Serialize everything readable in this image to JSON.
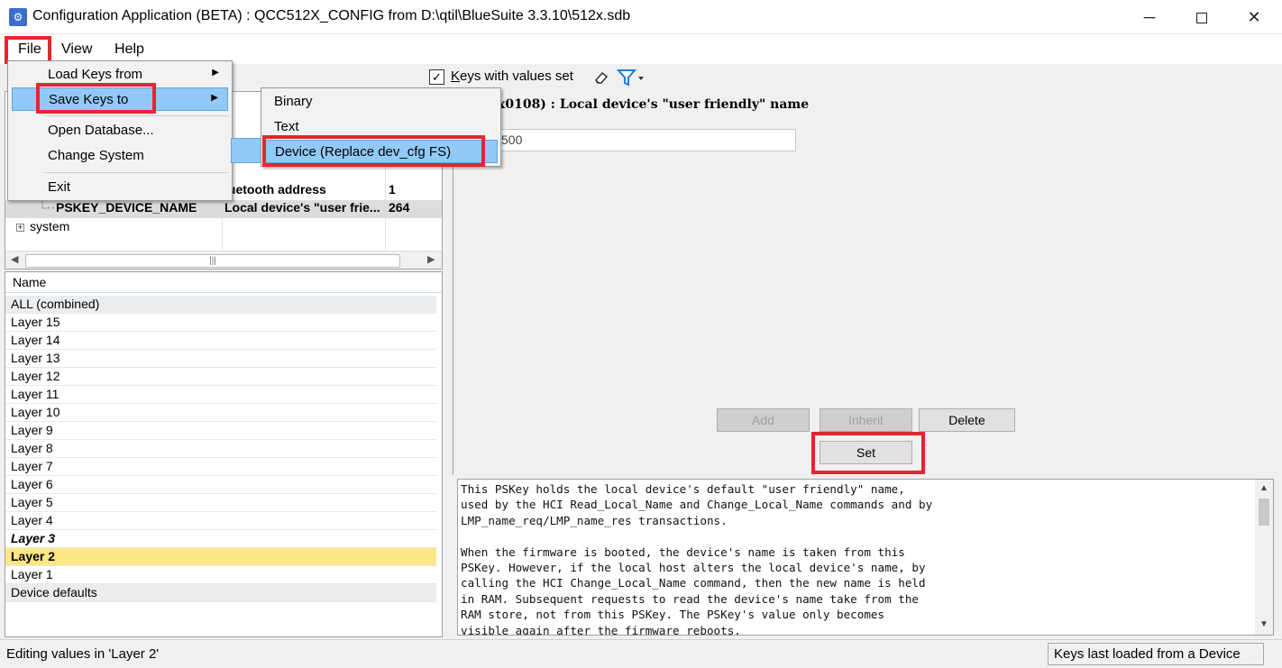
{
  "window": {
    "title": "Configuration Application (BETA) : QCC512X_CONFIG from D:\\qtil\\BlueSuite 3.3.10\\512x.sdb",
    "minimize": "─",
    "close": "✕"
  },
  "menubar": {
    "file": "File",
    "view": "View",
    "help": "Help"
  },
  "toolbar": {
    "keys_with_values_prefix": "K",
    "keys_with_values_rest": "eys with values set",
    "checked": "✓"
  },
  "file_menu": {
    "load_keys": "Load Keys from",
    "save_keys": "Save Keys to",
    "open_database": "Open Database...",
    "change_system": "Change System",
    "exit": "Exit",
    "arrow": "▶"
  },
  "save_submenu": {
    "binary": "Binary",
    "text": "Text",
    "device": "Device (Replace dev_cfg FS)"
  },
  "tree": {
    "bt_col2": "luetooth address",
    "bt_col3": "1",
    "pskey_col1": "PSKEY_DEVICE_NAME",
    "pskey_col2": "Local device's \"user frie...",
    "pskey_col3": "264",
    "system_label": "system",
    "expander": "+",
    "scroll_grip": "|||"
  },
  "layers": {
    "header": "Name",
    "items": [
      "ALL (combined)",
      "Layer 15",
      "Layer 14",
      "Layer 13",
      "Layer 12",
      "Layer 11",
      "Layer 10",
      "Layer 9",
      "Layer 8",
      "Layer 7",
      "Layer 6",
      "Layer 5",
      "Layer 4",
      "Layer 3",
      "Layer 2",
      "Layer 1",
      "Device defaults"
    ],
    "selected": "Layer 2"
  },
  "editor": {
    "key_title": "x0108) : Local device's \"user friendly\" name",
    "value": "500",
    "add": "Add",
    "inherit": "Inherit",
    "delete": "Delete",
    "set": "Set"
  },
  "description": "This PSKey holds the local device's default \"user friendly\" name,\nused by the HCI Read_Local_Name and Change_Local_Name commands and by\nLMP_name_req/LMP_name_res transactions.\n\nWhen the firmware is booted, the device's name is taken from this\nPSKey. However, if the local host alters the local device's name, by\ncalling the HCI Change_Local_Name command, then the new name is held\nin RAM. Subsequent requests to read the device's name take from the\nRAM store, not from this PSKey. The PSKey's value only becomes\nvisible again after the firmware reboots.",
  "status": {
    "left": "Editing values in 'Layer 2'",
    "right": "Keys last loaded from a Device"
  },
  "colors": {
    "highlight_red": "#e5252f",
    "menu_hot": "#91c9f7",
    "selected_layer": "#fde785"
  }
}
